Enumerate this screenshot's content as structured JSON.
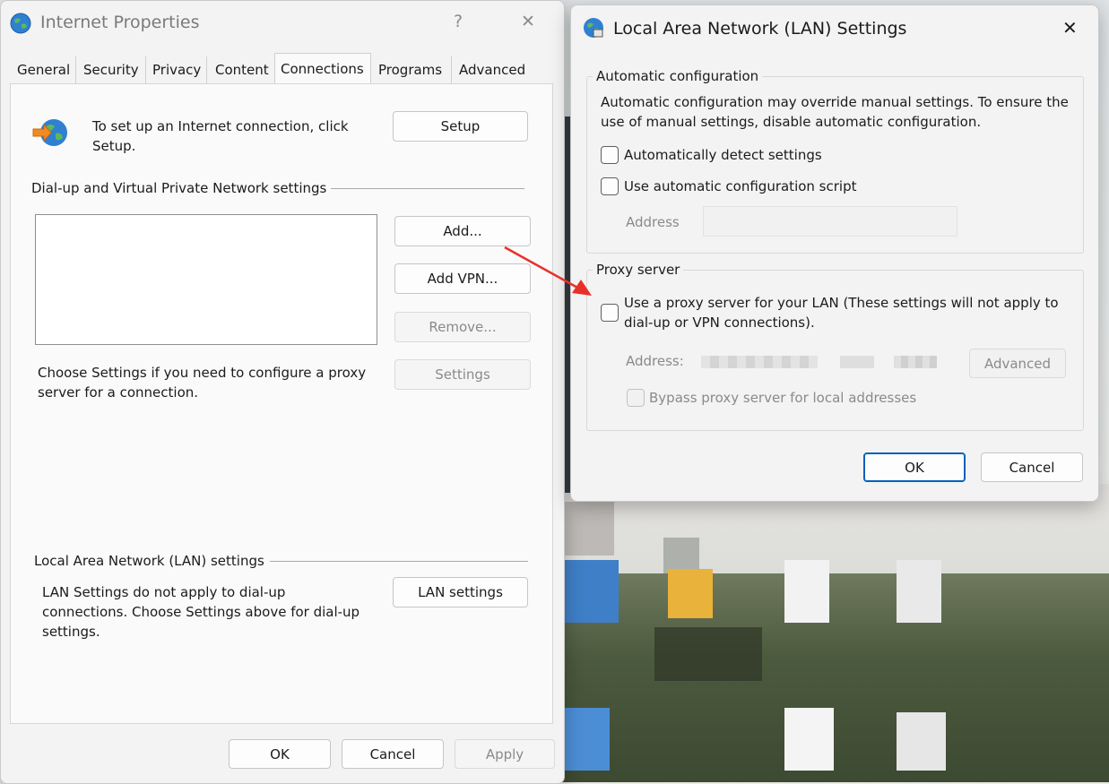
{
  "internet_properties": {
    "title": "Internet Properties",
    "help": "?",
    "close": "✕",
    "tabs": [
      "General",
      "Security",
      "Privacy",
      "Content",
      "Connections",
      "Programs",
      "Advanced"
    ],
    "active_tab": "Connections",
    "setup_text": "To set up an Internet connection, click Setup.",
    "setup_button": "Setup",
    "dialup_heading": "Dial-up and Virtual Private Network settings",
    "add_button": "Add...",
    "add_vpn_button": "Add VPN...",
    "remove_button": "Remove...",
    "settings_text": "Choose Settings if you need to configure a proxy server for a connection.",
    "settings_button": "Settings",
    "lan_heading": "Local Area Network (LAN) settings",
    "lan_text": "LAN Settings do not apply to dial-up connections. Choose Settings above for dial-up settings.",
    "lan_button": "LAN settings",
    "ok": "OK",
    "cancel": "Cancel",
    "apply": "Apply"
  },
  "lan_dialog": {
    "title": "Local Area Network (LAN) Settings",
    "close": "✕",
    "auto_group": "Automatic configuration",
    "auto_text": "Automatic configuration may override manual settings.  To ensure the use of manual settings, disable automatic configuration.",
    "auto_detect": "Automatically detect settings",
    "auto_script": "Use automatic configuration script",
    "address_label": "Address",
    "proxy_group": "Proxy server",
    "use_proxy": "Use a proxy server for your LAN (These settings will not apply to dial-up or VPN connections).",
    "proxy_address_label": "Address:",
    "advanced_button": "Advanced",
    "bypass": "Bypass proxy server for local addresses",
    "ok": "OK",
    "cancel": "Cancel"
  },
  "colors": {
    "accent": "#005fb8",
    "arrow": "#e8302a"
  }
}
